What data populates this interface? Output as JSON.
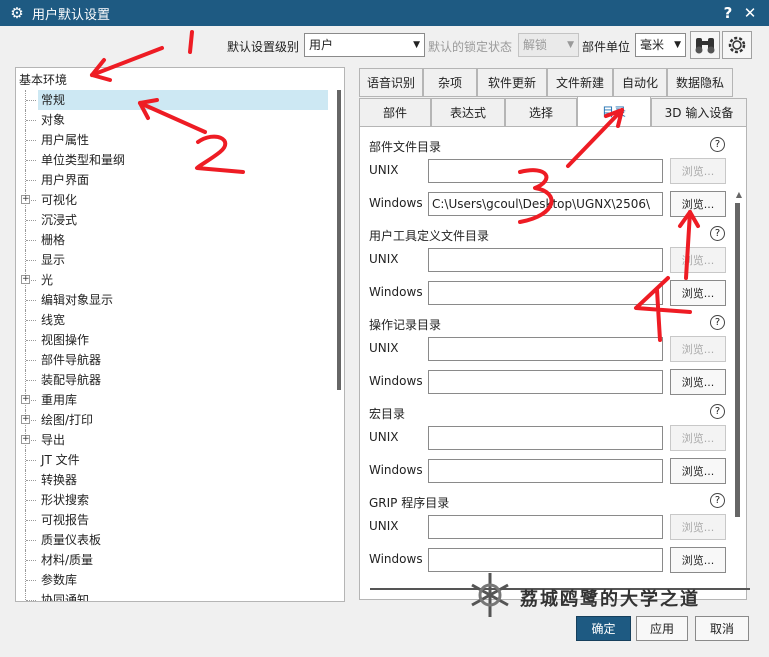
{
  "window": {
    "title": "用户默认设置",
    "help_glyph": "?",
    "close_glyph": "✕"
  },
  "toolbar": {
    "level_label": "默认设置级别",
    "level_value": "用户",
    "lock_label": "默认的锁定状态",
    "lock_value": "解锁",
    "unit_label": "部件单位",
    "unit_value": "毫米"
  },
  "tree": {
    "root": "基本环境",
    "items": [
      {
        "label": "常规",
        "expandable": false,
        "selected": true
      },
      {
        "label": "对象",
        "expandable": false
      },
      {
        "label": "用户属性",
        "expandable": false
      },
      {
        "label": "单位类型和量纲",
        "expandable": false
      },
      {
        "label": "用户界面",
        "expandable": false
      },
      {
        "label": "可视化",
        "expandable": true
      },
      {
        "label": "沉浸式",
        "expandable": false
      },
      {
        "label": "栅格",
        "expandable": false
      },
      {
        "label": "显示",
        "expandable": false
      },
      {
        "label": "光",
        "expandable": true
      },
      {
        "label": "编辑对象显示",
        "expandable": false
      },
      {
        "label": "线宽",
        "expandable": false
      },
      {
        "label": "视图操作",
        "expandable": false
      },
      {
        "label": "部件导航器",
        "expandable": false
      },
      {
        "label": "装配导航器",
        "expandable": false
      },
      {
        "label": "重用库",
        "expandable": true
      },
      {
        "label": "绘图/打印",
        "expandable": true
      },
      {
        "label": "导出",
        "expandable": true
      },
      {
        "label": "JT 文件",
        "expandable": false
      },
      {
        "label": "转换器",
        "expandable": false
      },
      {
        "label": "形状搜索",
        "expandable": false
      },
      {
        "label": "可视报告",
        "expandable": false
      },
      {
        "label": "质量仪表板",
        "expandable": false
      },
      {
        "label": "材料/质量",
        "expandable": false
      },
      {
        "label": "参数库",
        "expandable": false
      },
      {
        "label": "协同通知",
        "expandable": false
      }
    ]
  },
  "tabs": {
    "row1": [
      "语音识别",
      "杂项",
      "软件更新",
      "文件新建",
      "自动化",
      "数据隐私"
    ],
    "row2": [
      "部件",
      "表达式",
      "选择",
      "目录",
      "3D 输入设备"
    ],
    "active": "目录"
  },
  "sections": [
    {
      "title": "部件文件目录",
      "unix": "",
      "windows": "C:\\Users\\gcoul\\Desktop\\UGNX\\2506\\"
    },
    {
      "title": "用户工具定义文件目录",
      "unix": "",
      "windows": ""
    },
    {
      "title": "操作记录目录",
      "unix": "",
      "windows": ""
    },
    {
      "title": "宏目录",
      "unix": "",
      "windows": ""
    },
    {
      "title": "GRIP 程序目录",
      "unix": "",
      "windows": ""
    }
  ],
  "labels": {
    "unix": "UNIX",
    "windows": "Windows",
    "browse": "浏览...",
    "help": "?"
  },
  "buttons": {
    "ok": "确定",
    "apply": "应用",
    "cancel": "取消"
  },
  "annotations": [
    "1",
    "2",
    "3",
    "4"
  ],
  "watermark": "荔城鸥鹭的大学之道",
  "colors": {
    "titlebar": "#1e5a82",
    "selected": "#cde8f3",
    "active_tab_text": "#1e6fb0",
    "annotation": "#ee1c24"
  }
}
